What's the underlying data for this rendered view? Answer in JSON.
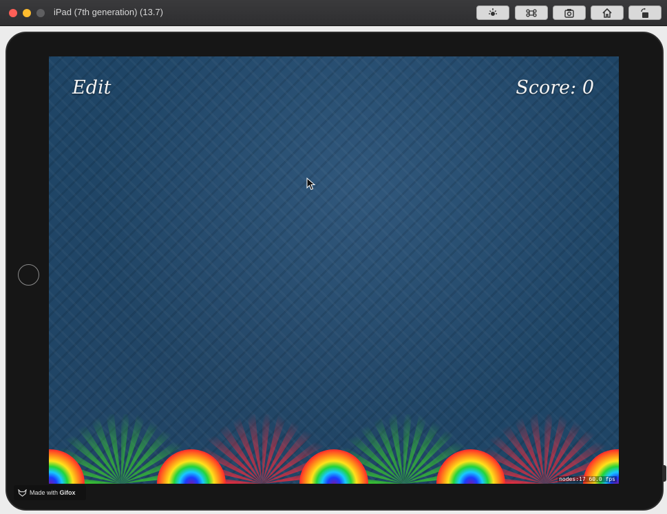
{
  "window": {
    "title": "iPad (7th generation) (13.7)",
    "toolbar": [
      "brightness-icon",
      "command-icon",
      "screenshot-icon",
      "home-icon",
      "rotate-icon"
    ]
  },
  "game": {
    "edit_label": "Edit",
    "score_label": "Score: 0",
    "debug_stats": "nodes:17  60.0 fps"
  },
  "watermark": {
    "prefix": "Made with",
    "brand": "Gifox"
  },
  "colors": {
    "background": "#1f4566",
    "red": "#ff2a3a",
    "green": "#3bd62a"
  }
}
